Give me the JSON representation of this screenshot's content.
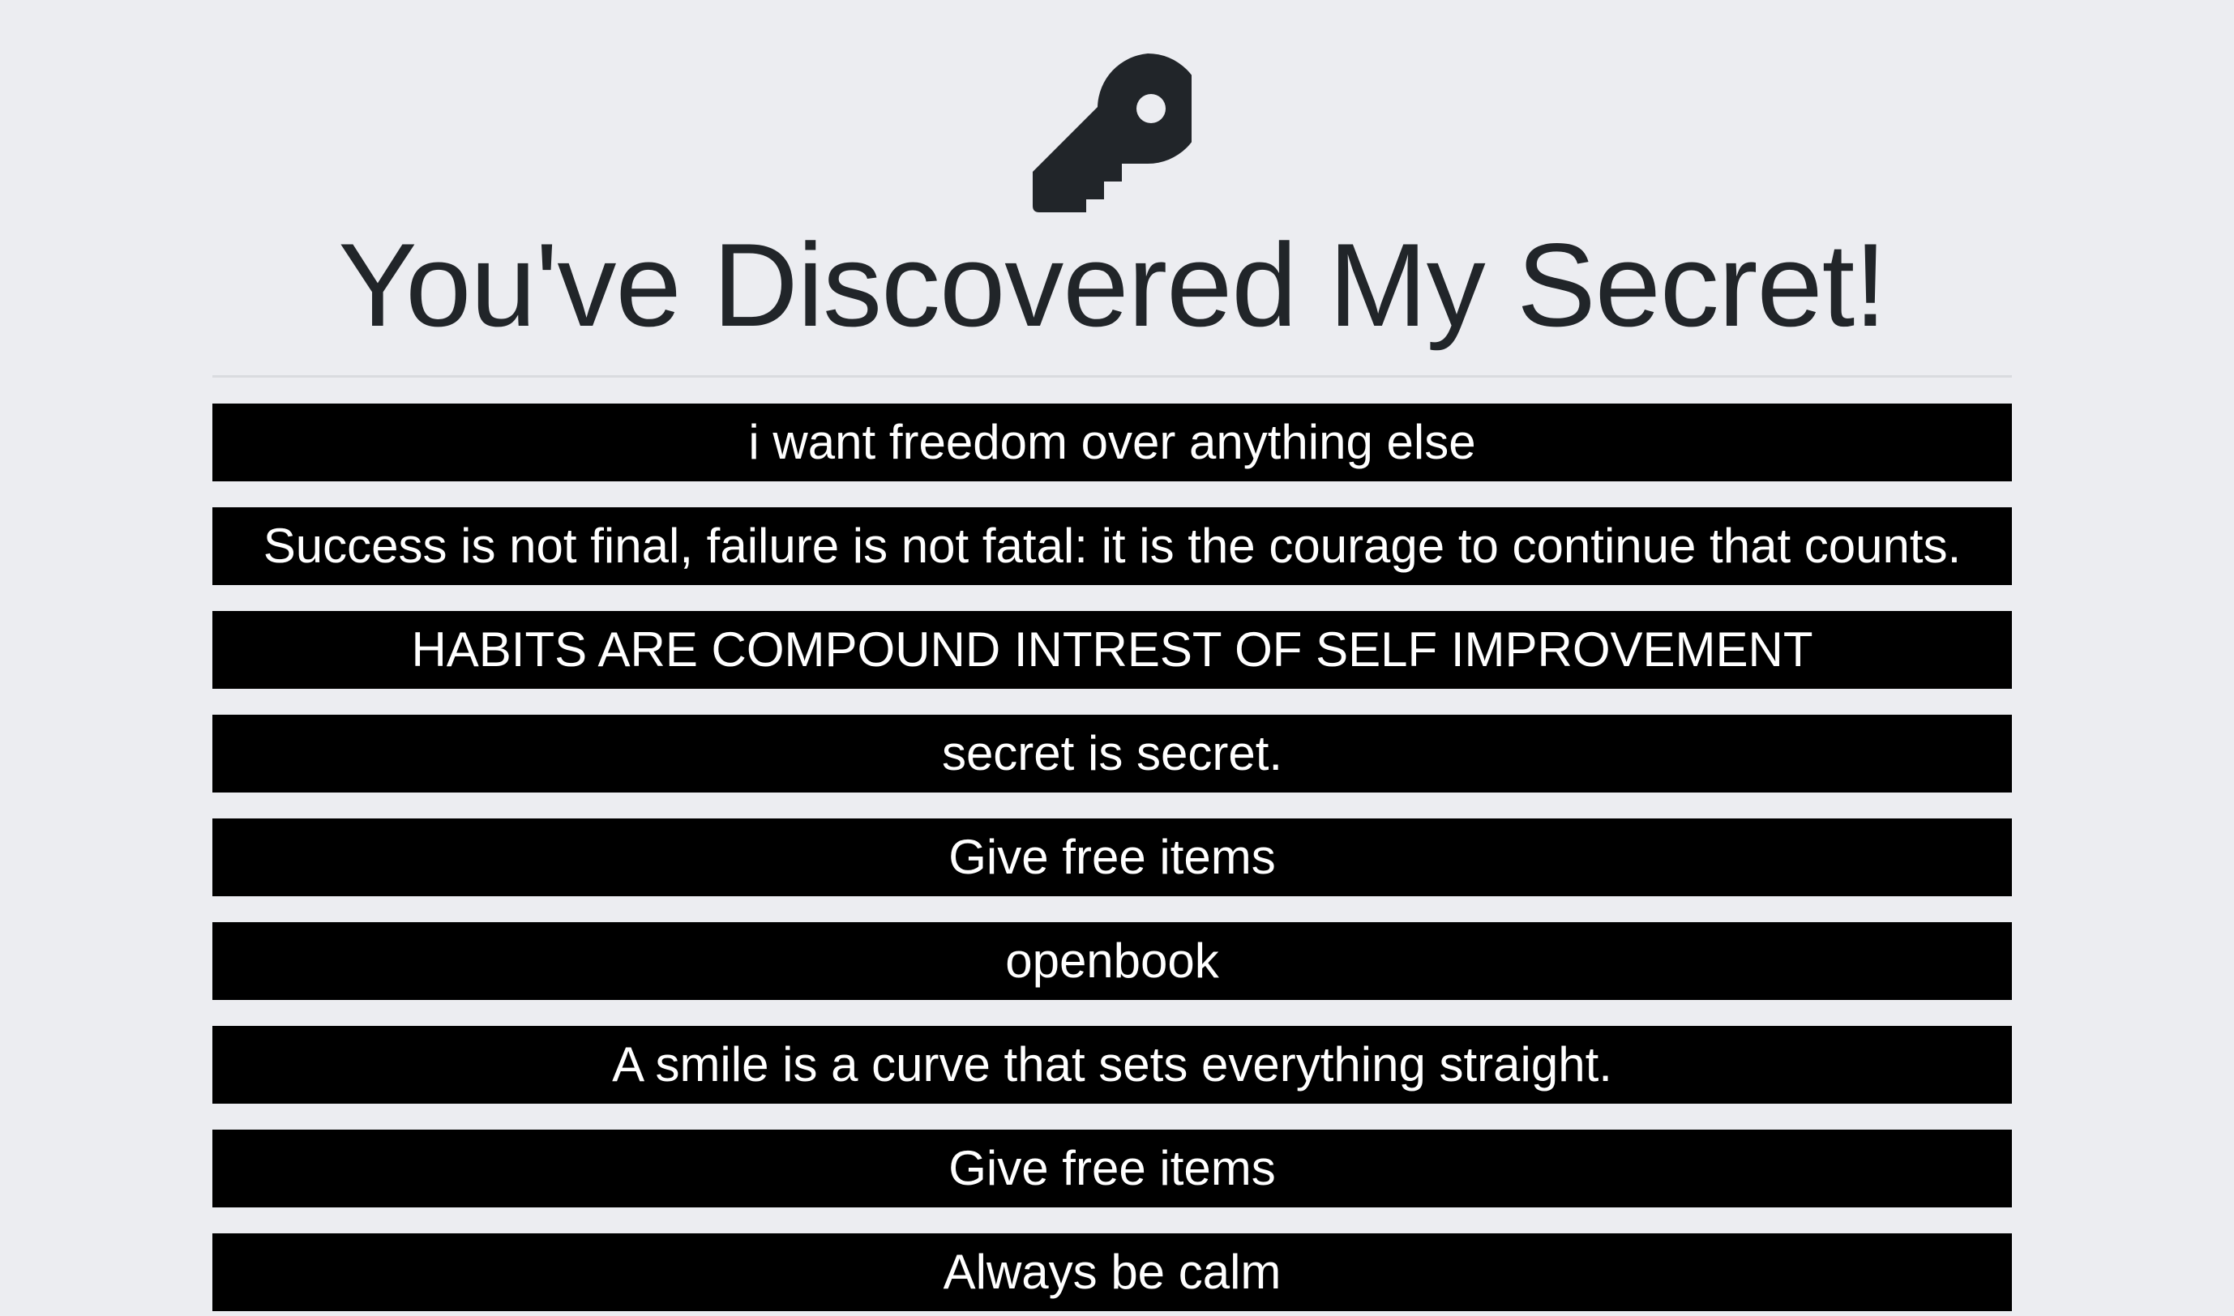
{
  "header": {
    "icon": "key-icon",
    "title": "You've Discovered My Secret!"
  },
  "secrets": [
    "i want freedom over anything else",
    "Success is not final, failure is not fatal: it is the courage to continue that counts.",
    "HABITS ARE COMPOUND INTREST OF SELF IMPROVEMENT",
    "secret is secret.",
    "Give free items",
    "openbook",
    "A smile is a curve that sets everything straight.",
    "Give free items",
    "Always be calm"
  ],
  "colors": {
    "background": "#ECEDF1",
    "title_text": "#212529",
    "secret_background": "#000000",
    "secret_text": "#FFFFFF"
  }
}
